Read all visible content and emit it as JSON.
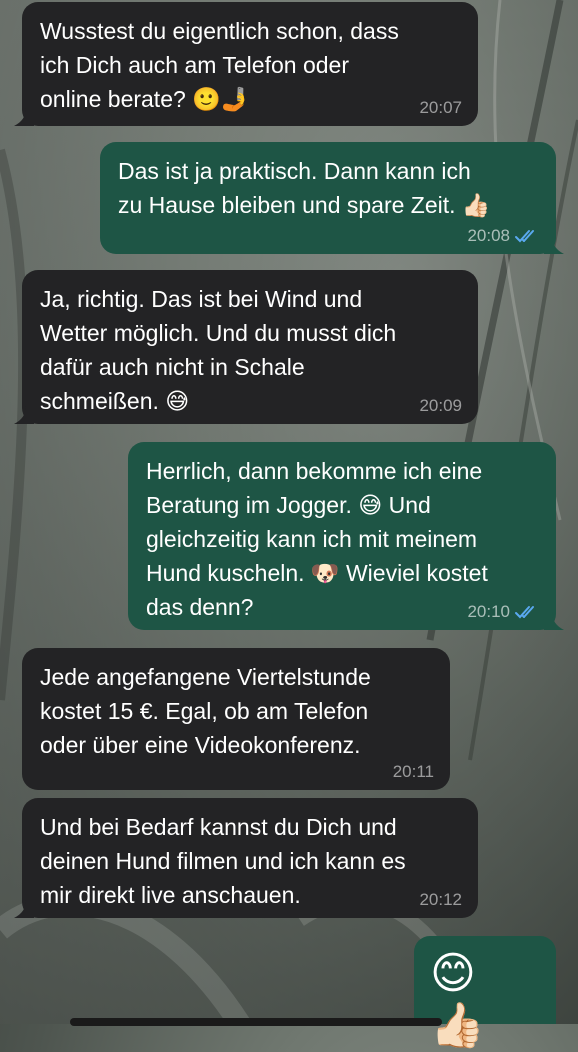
{
  "messages": [
    {
      "direction": "incoming",
      "text": "Wusstest du eigentlich schon, dass\nich Dich auch am Telefon oder\nonline berate? 🙂🤳",
      "time": "20:07"
    },
    {
      "direction": "outgoing",
      "text": "Das ist ja praktisch. Dann kann ich\nzu Hause bleiben und spare Zeit. 👍🏻",
      "time": "20:08",
      "status_icon": "double-check-read-icon"
    },
    {
      "direction": "incoming",
      "text": "Ja, richtig. Das ist bei Wind und\nWetter möglich. Und du musst dich\ndafür auch nicht in Schale\nschmeißen. 😅",
      "time": "20:09"
    },
    {
      "direction": "outgoing",
      "text": "Herrlich, dann bekomme ich eine\nBeratung im Jogger. 😅 Und\ngleichzeitig kann ich mit meinem\nHund kuscheln. 🐶 Wieviel kostet\ndas denn?",
      "time": "20:10",
      "status_icon": "double-check-read-icon"
    },
    {
      "direction": "incoming",
      "text": "Jede angefangene Viertelstunde\nkostet 15 €. Egal, ob am Telefon\noder über eine Videokonferenz.",
      "time": "20:11"
    },
    {
      "direction": "incoming",
      "text": "Und bei Bedarf kannst du Dich und\ndeinen Hund filmen und ich kann es\nmir direkt live anschauen.",
      "time": "20:12"
    },
    {
      "direction": "outgoing",
      "text": "😊👍🏻"
    }
  ],
  "colors": {
    "incoming_bubble": "#232325",
    "outgoing_bubble": "#1e5545",
    "read_ticks": "#5aa9f0"
  }
}
